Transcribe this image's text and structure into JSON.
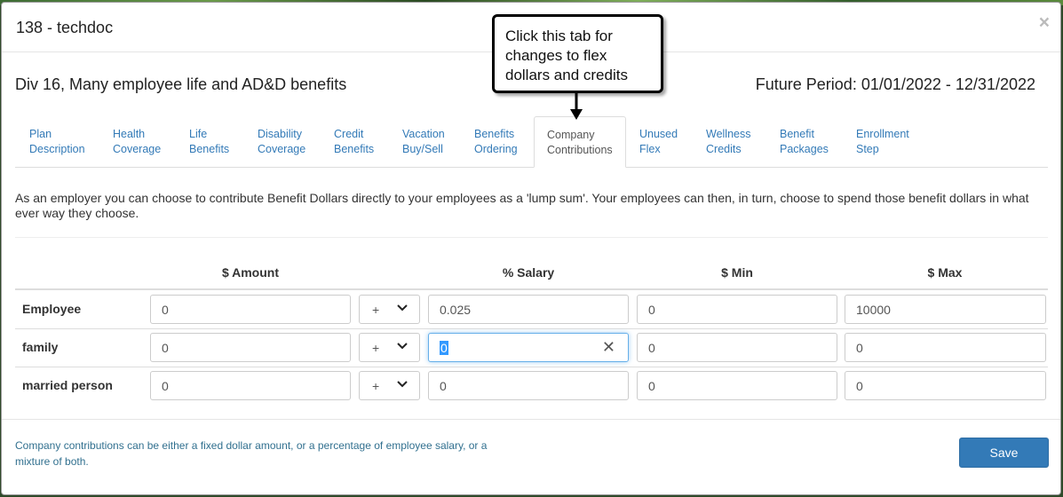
{
  "modal": {
    "title": "138 - techdoc",
    "close_glyph": "×"
  },
  "plan": {
    "title": "Div 16, Many employee life and AD&D benefits",
    "period": "Future Period: 01/01/2022 - 12/31/2022"
  },
  "tabs": [
    {
      "line1": "Plan",
      "line2": "Description"
    },
    {
      "line1": "Health",
      "line2": "Coverage"
    },
    {
      "line1": "Life",
      "line2": "Benefits"
    },
    {
      "line1": "Disability",
      "line2": "Coverage"
    },
    {
      "line1": "Credit",
      "line2": "Benefits"
    },
    {
      "line1": "Vacation",
      "line2": "Buy/Sell"
    },
    {
      "line1": "Benefits",
      "line2": "Ordering"
    },
    {
      "line1": "Company",
      "line2": "Contributions",
      "active": true
    },
    {
      "line1": "Unused",
      "line2": "Flex"
    },
    {
      "line1": "Wellness",
      "line2": "Credits"
    },
    {
      "line1": "Benefit",
      "line2": "Packages"
    },
    {
      "line1": "Enrollment",
      "line2": "Step"
    }
  ],
  "description": "As an employer you can choose to contribute Benefit Dollars directly to your employees as a 'lump sum'. Your employees can then, in turn, choose to spend those benefit dollars in what ever way they choose.",
  "table": {
    "headers": {
      "amount": "$ Amount",
      "salary": "% Salary",
      "min": "$ Min",
      "max": "$ Max"
    },
    "rows": [
      {
        "label": "Employee",
        "amount": "0",
        "operator": "+",
        "salary": "0.025",
        "min": "0",
        "max": "10000"
      },
      {
        "label": "family",
        "amount": "0",
        "operator": "+",
        "salary": "0",
        "min": "0",
        "max": "0"
      },
      {
        "label": "married person",
        "amount": "0",
        "operator": "+",
        "salary": "0",
        "min": "0",
        "max": "0"
      }
    ]
  },
  "footer": {
    "note": "Company contributions can be either a fixed dollar amount, or a percentage of employee salary, or a mixture of both.",
    "save_label": "Save"
  },
  "callout": {
    "text": "Click this tab for changes to flex dollars and credits"
  },
  "icons": {
    "close": "close-icon",
    "chevron": "chevron-down-icon",
    "clear": "clear-icon"
  },
  "colors": {
    "link": "#337ab7",
    "primary_button": "#337ab7",
    "note_text": "#31708f",
    "focus": "#66afe9"
  }
}
